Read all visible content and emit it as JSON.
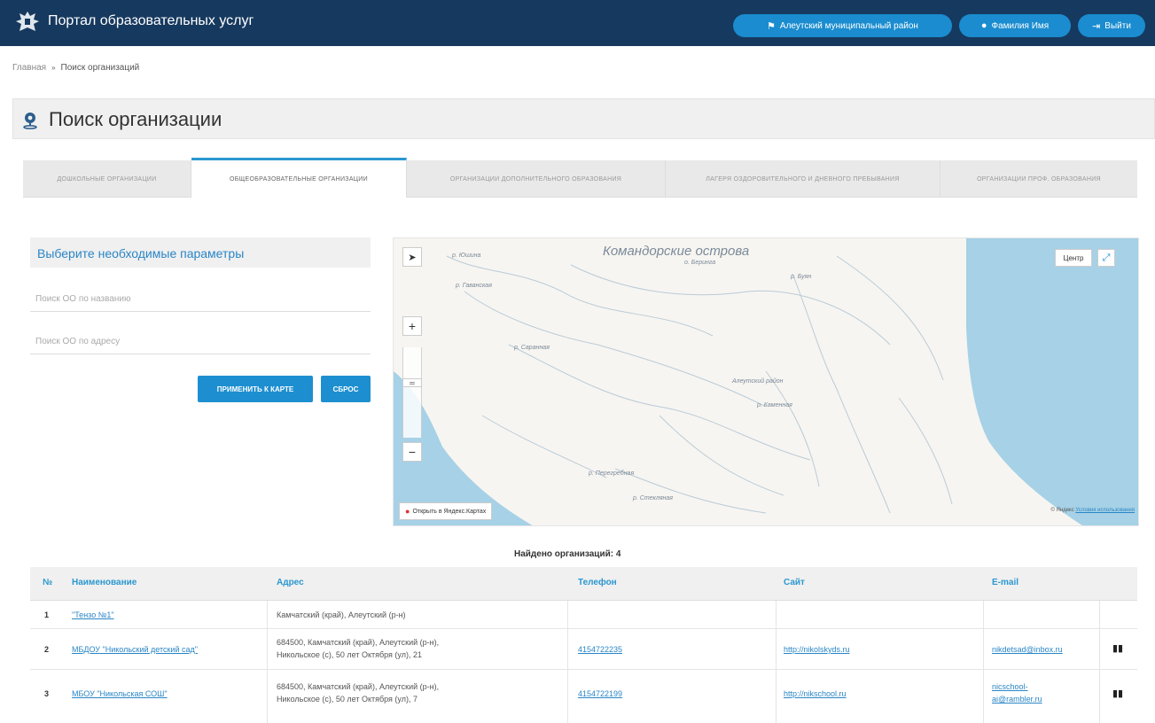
{
  "header": {
    "app_title": "Портал образовательных услуг",
    "region_button": "Алеутский муниципальный район",
    "user_button": "Фамилия Имя",
    "logout_button": "Выйти",
    "bg_color": "#16395f",
    "button_color": "#1a8ccf"
  },
  "breadcrumb": {
    "home": "Главная",
    "separator": "»",
    "current": "Поиск организаций"
  },
  "page_title": "Поиск организации",
  "tabs": [
    {
      "label": "Дошкольные организации",
      "active": false
    },
    {
      "label": "Общеобразовательные организации",
      "active": true
    },
    {
      "label": "Организации дополнительного образования",
      "active": false
    },
    {
      "label": "Лагеря оздоровительного и дневного пребывания",
      "active": false
    },
    {
      "label": "Организации проф. образования",
      "active": false
    }
  ],
  "filter": {
    "title": "Выберите необходимые параметры",
    "name_placeholder": "Поиск ОО по названию",
    "address_placeholder": "Поиск ОО по адресу",
    "apply_button": "ПРИМЕНИТЬ К КАРТЕ",
    "reset_button": "СБРОС"
  },
  "map": {
    "islands_label": "Командорские острова",
    "labels": [
      "о. Беринга",
      "р. Юшина",
      "р. Гаванская",
      "р. Саранная",
      "р. Буян",
      "р. Каменная",
      "р. Половинка",
      "Алеутский район",
      "р. Перегребная",
      "р. Стекляная"
    ],
    "center_button": "Центр",
    "zoom_in": "+",
    "zoom_out": "−",
    "open_in_yandex": "Открыть в Яндекс.Картах",
    "copyright": "© Яндекс",
    "terms": "Условия использования",
    "water_color": "#a6d1e6",
    "land_color": "#f7f5f1"
  },
  "results": {
    "found_label": "Найдено организаций: 4",
    "columns": [
      "№",
      "Наименование",
      "Адрес",
      "Телефон",
      "Сайт",
      "E-mail"
    ],
    "rows": [
      {
        "num": "1",
        "name": "\"Тензо №1\"",
        "address": "Камчатский (край), Алеутский (р-н)",
        "address2": "",
        "phone": "",
        "site": "",
        "email": "",
        "email2": ""
      },
      {
        "num": "2",
        "name": "МБДОУ \"Никольский детский сад\"",
        "address": "684500, Камчатский (край), Алеутский (р-н),",
        "address2": "Никольское (с), 50 лет Октября (ул), 21",
        "phone": "4154722235",
        "site": "http://nikolskyds.ru",
        "email": "nikdetsad@inbox.ru",
        "email2": ""
      },
      {
        "num": "3",
        "name": "МБОУ \"Никольская СОШ\"",
        "address": "684500, Камчатский (край), Алеутский (р-н),",
        "address2": "Никольское (с), 50 лет Октября (ул), 7",
        "phone": "4154722199",
        "site": "http://nikschool.ru",
        "email": "nicschool-",
        "email2": "ai@rambler.ru"
      }
    ]
  }
}
